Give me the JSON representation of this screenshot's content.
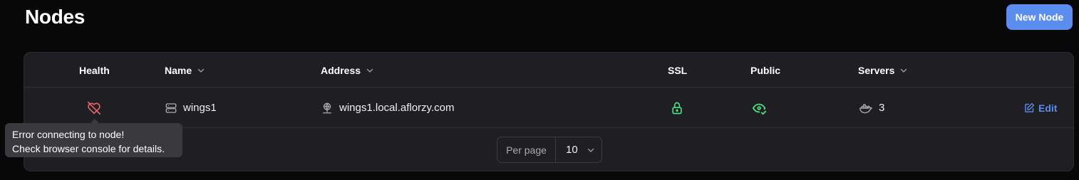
{
  "header": {
    "title": "Nodes",
    "new_button": "New Node"
  },
  "table": {
    "columns": {
      "health": "Health",
      "name": "Name",
      "address": "Address",
      "ssl": "SSL",
      "public": "Public",
      "servers": "Servers"
    },
    "rows": [
      {
        "health_icon": "heart-off-icon",
        "name_icon": "server-icon",
        "name": "wings1",
        "address_icon": "network-globe-icon",
        "address": "wings1.local.aflorzy.com",
        "ssl_icon": "lock-icon",
        "public_icon": "eye-check-icon",
        "servers_icon": "docker-icon",
        "servers": "3",
        "edit_label": "Edit",
        "edit_icon": "edit-icon"
      }
    ]
  },
  "pagination": {
    "per_page_label": "Per page",
    "per_page_value": "10"
  },
  "tooltip": {
    "line1": "Error connecting to node!",
    "line2": "Check browser console for details."
  },
  "colors": {
    "accent": "#5b8def",
    "health_error": "#e8636b",
    "success": "#4ade80",
    "background": "#080809",
    "card": "#1f1f23"
  }
}
